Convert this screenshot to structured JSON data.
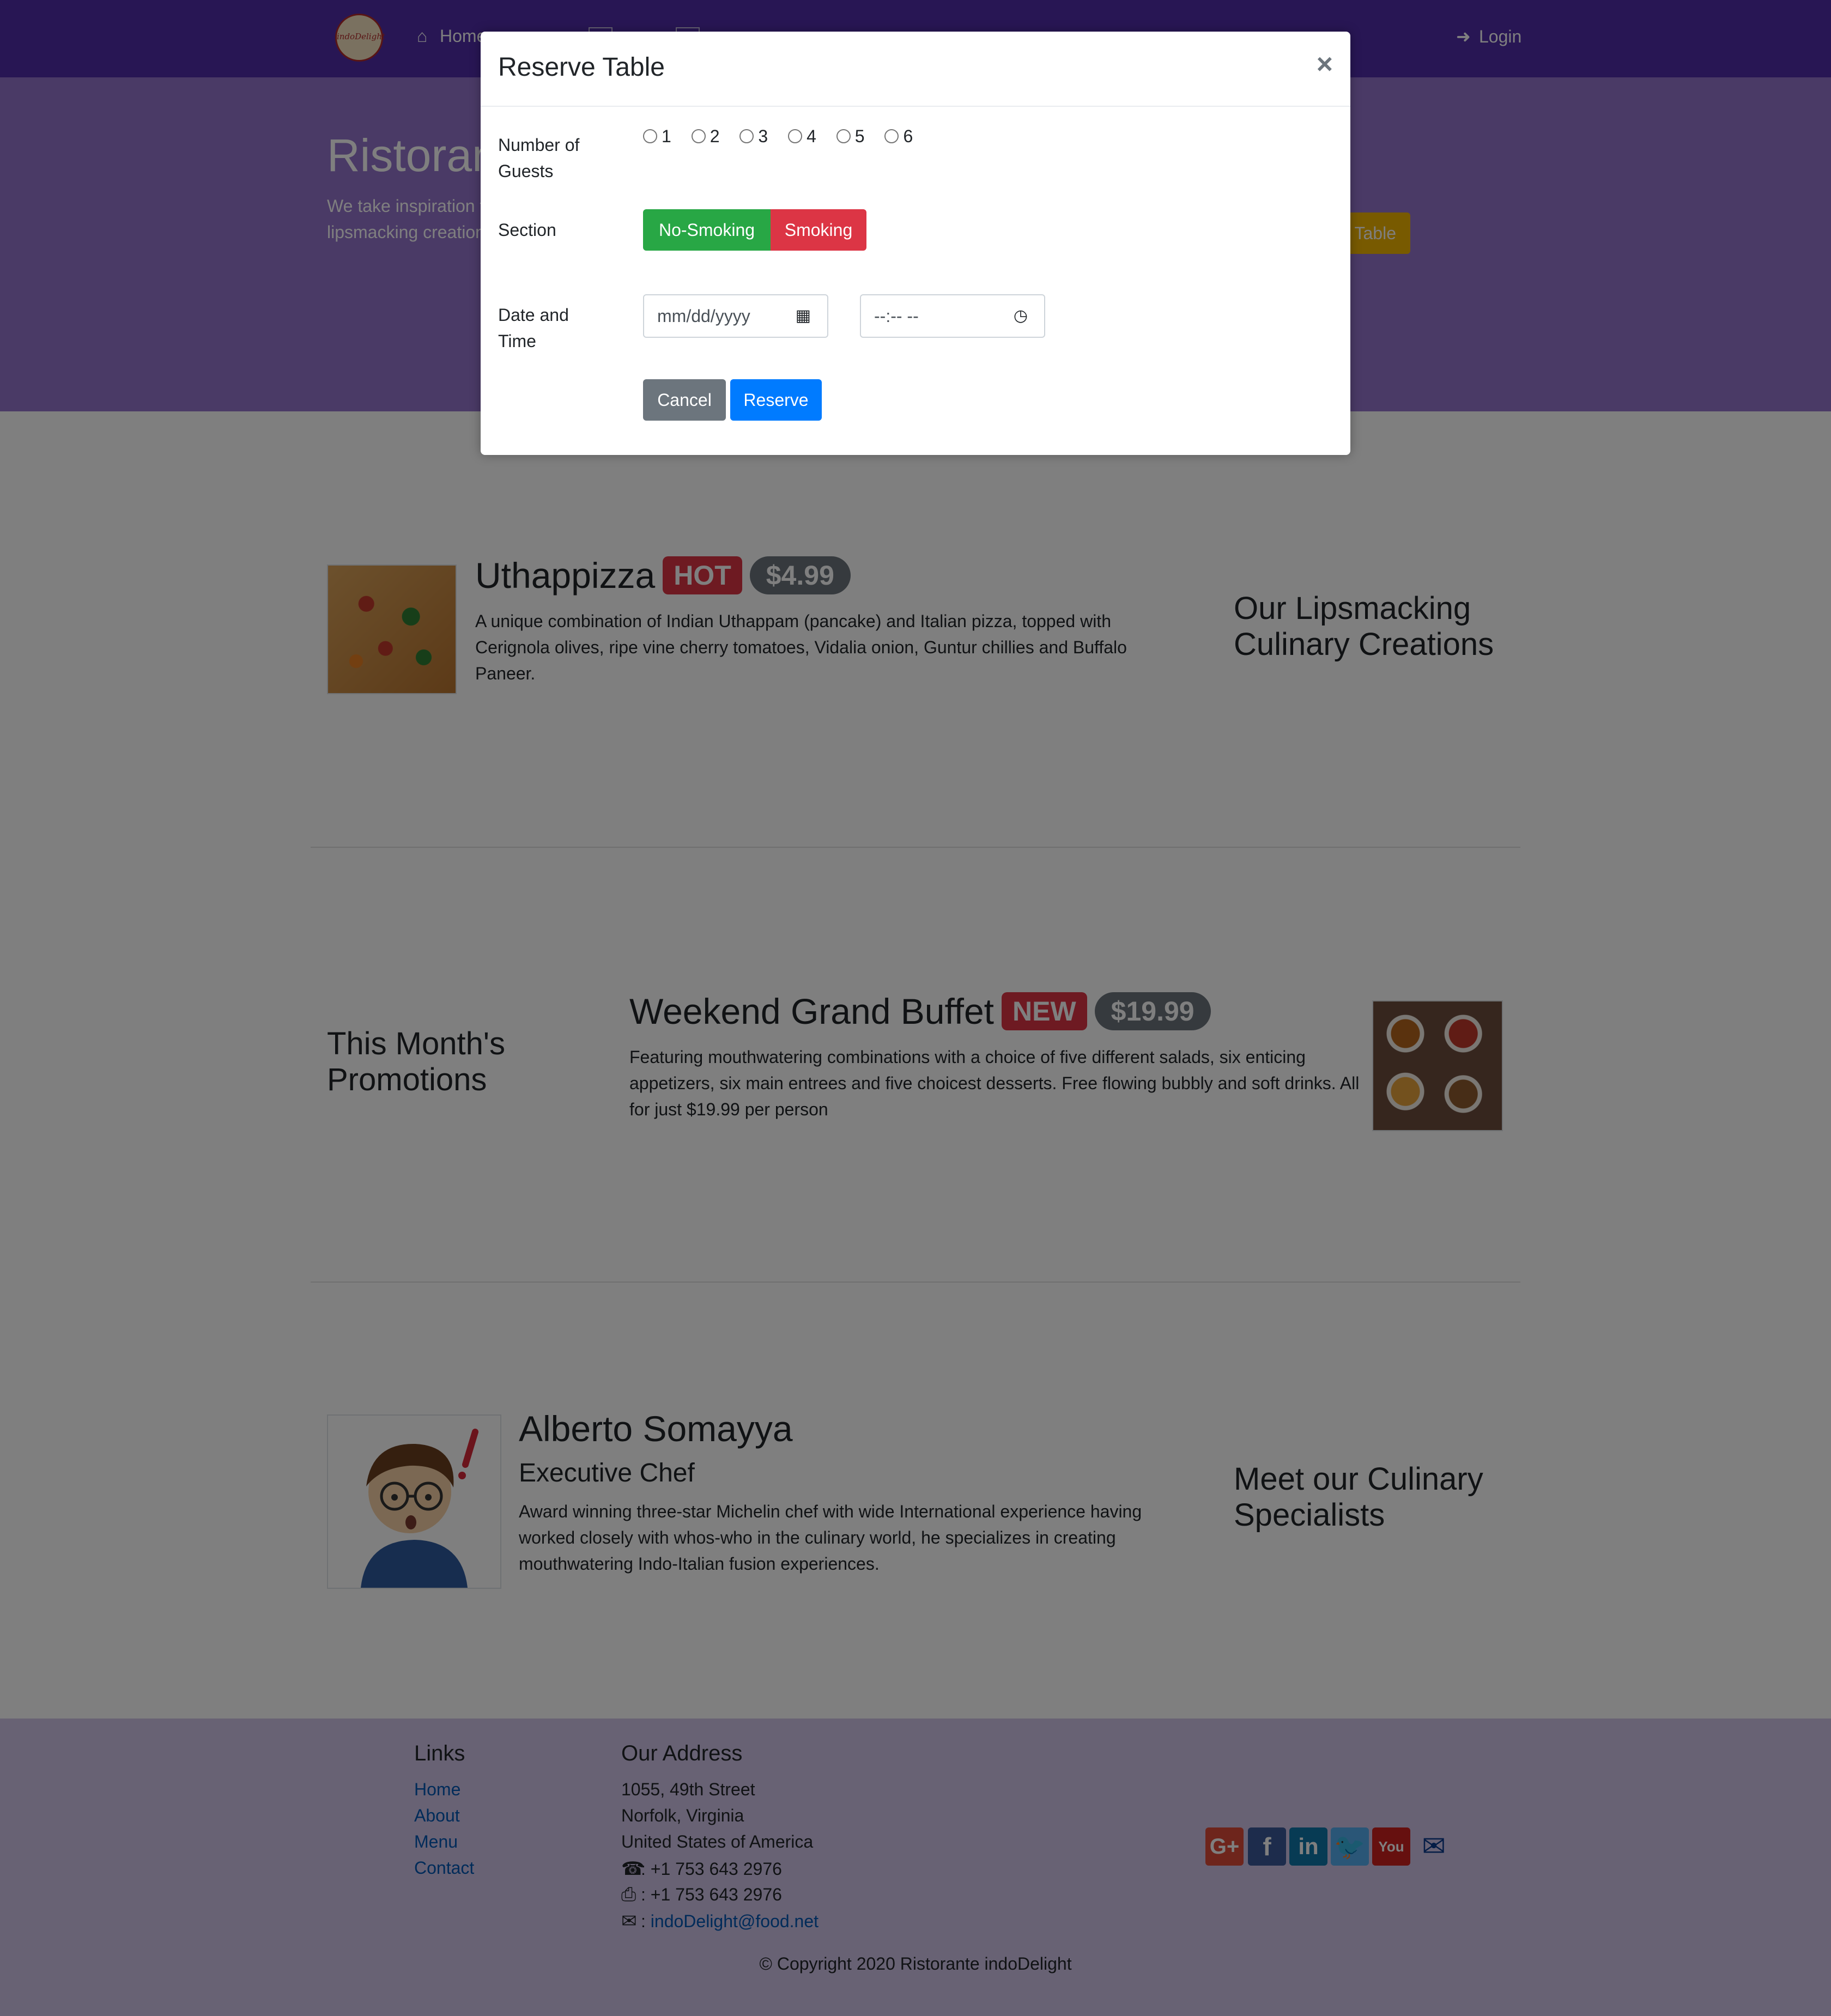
{
  "nav": {
    "logo_text": "indoDelight",
    "home": "Home",
    "login": "Login"
  },
  "jumbotron": {
    "title": "Ristorante indoDelight",
    "text": "We take inspiration from the World's best cuisines, and create a unique fusion experience. Our lipsmacking creations will tickle your culinary senses!",
    "reserve_button": "Reserve Table"
  },
  "dish": {
    "name": "Uthappizza",
    "badge": "HOT",
    "price": "$4.99",
    "description": "A unique combination of Indian Uthappam (pancake) and Italian pizza, topped with Cerignola olives, ripe vine cherry tomatoes, Vidalia onion, Guntur chillies and Buffalo Paneer.",
    "side_title": "Our Lipsmacking Culinary Creations"
  },
  "promotion": {
    "side_title": "This Month's Promotions",
    "name": "Weekend Grand Buffet",
    "badge": "NEW",
    "price": "$19.99",
    "description": "Featuring mouthwatering combinations with a choice of five different salads, six enticing appetizers, six main entrees and five choicest desserts. Free flowing bubbly and soft drinks. All for just $19.99 per person"
  },
  "chef": {
    "name": "Alberto Somayya",
    "role": "Executive Chef",
    "description": "Award winning three-star Michelin chef with wide International experience having worked closely with whos-who in the culinary world, he specializes in creating mouthwatering Indo-Italian fusion experiences.",
    "side_title": "Meet our Culinary Specialists"
  },
  "footer": {
    "links_heading": "Links",
    "links": [
      "Home",
      "About",
      "Menu",
      "Contact"
    ],
    "address_heading": "Our Address",
    "address": [
      "1055, 49th Street",
      "Norfolk, Virginia",
      "United States of America"
    ],
    "phone": ": +1 753 643 2976",
    "fax": ": +1 753 643 2976",
    "email": "indoDelight@food.net",
    "copyright": "© Copyright 2020 Ristorante indoDelight"
  },
  "modal": {
    "title": "Reserve Table",
    "close": "×",
    "guests_label": "Number of Guests",
    "guest_options": [
      "1",
      "2",
      "3",
      "4",
      "5",
      "6"
    ],
    "section_label": "Section",
    "section_options": [
      "No-Smoking",
      "Smoking"
    ],
    "datetime_label": "Date and Time",
    "date_placeholder": "mm/dd/yyyy",
    "time_placeholder": "--:-- --",
    "cancel": "Cancel",
    "reserve": "Reserve"
  },
  "colors": {
    "navbar": "#512DA8",
    "jumbotron": "#9575CD",
    "footer": "#D1C4E9",
    "no_smoking": "#28a745",
    "smoking": "#dc3545",
    "reserve": "#007bff",
    "cancel": "#6c757d"
  },
  "icons": [
    "home-icon",
    "sign-in-icon",
    "phone-icon",
    "fax-icon",
    "envelope-icon",
    "google-plus-icon",
    "facebook-icon",
    "linkedin-icon",
    "twitter-icon",
    "youtube-icon",
    "mail-icon",
    "calendar-icon",
    "clock-icon"
  ]
}
